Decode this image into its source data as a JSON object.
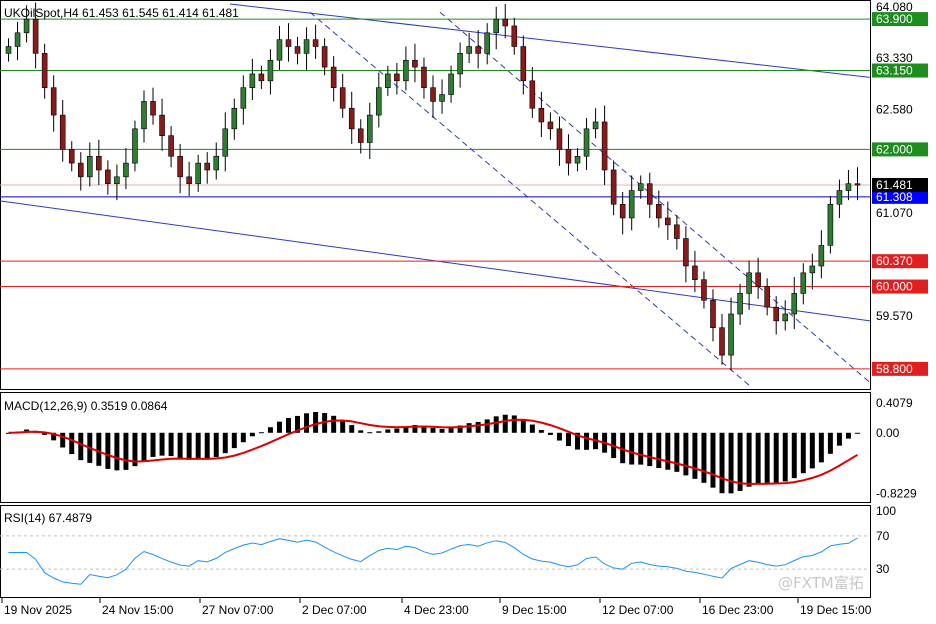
{
  "colors": {
    "bull": "#2e7d32",
    "bear": "#8b1a1a",
    "green_level": "#1e8c1e",
    "red_level": "#e02020",
    "blue_level": "#0000cc",
    "channel": "#2b3bc0",
    "macd_signal": "#dd0000",
    "rsi_line": "#1e90ff",
    "grid": "#c0c0c0",
    "label_bg_blue": "#0000ff",
    "label_bg_black": "#000000"
  },
  "main": {
    "title": "UKOilSpot,H4  61.453 61.545 61.414 61.481",
    "price_ticks": [
      "64.080",
      "63.330",
      "62.580",
      "61.070",
      "59.570",
      "58.800"
    ],
    "ylim": [
      58.55,
      64.12
    ],
    "levels": [
      {
        "value": 63.9,
        "label": "63.900",
        "type": "green"
      },
      {
        "value": 63.15,
        "label": "63.150",
        "type": "green"
      },
      {
        "value": 62.0,
        "label": "62.000",
        "type": "green"
      },
      {
        "value": 60.37,
        "label": "60.370",
        "type": "red"
      },
      {
        "value": 60.0,
        "label": "60.000",
        "type": "red"
      },
      {
        "value": 58.8,
        "label": "58.800",
        "type": "red"
      },
      {
        "value": 61.308,
        "label": "61.308",
        "type": "blue"
      }
    ],
    "current_price": {
      "value": 61.481,
      "label": "61.481"
    },
    "candles": []
  },
  "macd": {
    "title": "MACD(12,26,9)  0.3519  0.0864",
    "ticks": [
      "0.4079",
      "0.00",
      "-0.8229"
    ],
    "ylim": [
      -0.9,
      0.5
    ]
  },
  "rsi": {
    "title": "RSI(14)  67.4879",
    "ticks": [
      "100",
      "70",
      "30"
    ],
    "ylim": [
      0,
      100
    ]
  },
  "time_axis": [
    "19 Nov 2025",
    "24 Nov 15:00",
    "27 Nov 07:00",
    "2 Dec 07:00",
    "4 Dec 23:00",
    "9 Dec 15:00",
    "12 Dec 07:00",
    "16 Dec 23:00",
    "19 Dec 15:00"
  ],
  "watermark": "@FXTM富拓",
  "chart_data": [
    {
      "type": "candlestick",
      "title": "UKOilSpot,H4",
      "ohlc_last": {
        "open": 61.453,
        "high": 61.545,
        "low": 61.414,
        "close": 61.481
      },
      "ylim": [
        58.55,
        64.12
      ],
      "series": [
        {
          "name": "close",
          "values": [
            63.5,
            63.7,
            63.9,
            63.4,
            62.9,
            62.5,
            62.0,
            61.8,
            61.6,
            61.9,
            61.7,
            61.5,
            61.6,
            61.8,
            62.3,
            62.7,
            62.5,
            62.2,
            61.9,
            61.6,
            61.5,
            61.8,
            61.7,
            61.9,
            62.3,
            62.6,
            62.9,
            63.1,
            63.0,
            63.3,
            63.6,
            63.5,
            63.4,
            63.6,
            63.5,
            63.2,
            62.9,
            62.6,
            62.3,
            62.1,
            62.5,
            62.9,
            63.1,
            63.0,
            63.3,
            63.2,
            62.9,
            62.7,
            62.8,
            63.1,
            63.4,
            63.5,
            63.4,
            63.7,
            63.9,
            63.8,
            63.5,
            63.0,
            62.6,
            62.4,
            62.3,
            62.0,
            61.8,
            61.9,
            62.3,
            62.4,
            61.7,
            61.2,
            61.0,
            61.4,
            61.5,
            61.2,
            61.0,
            60.9,
            60.7,
            60.3,
            60.1,
            59.8,
            59.4,
            59.0,
            59.6,
            59.9,
            60.2,
            60.0,
            59.7,
            59.5,
            59.6,
            59.9,
            60.2,
            60.3,
            60.6,
            61.2,
            61.4,
            61.5,
            61.48
          ]
        }
      ],
      "levels": [
        63.9,
        63.15,
        62.0,
        61.308,
        60.37,
        60.0,
        58.8
      ]
    },
    {
      "type": "bar",
      "title": "MACD(12,26,9)",
      "main": 0.3519,
      "signal": 0.0864,
      "ylim": [
        -0.8229,
        0.4079
      ]
    },
    {
      "type": "line",
      "title": "RSI(14)",
      "last": 67.4879,
      "ylim": [
        0,
        100
      ],
      "levels": [
        70,
        30
      ]
    }
  ]
}
